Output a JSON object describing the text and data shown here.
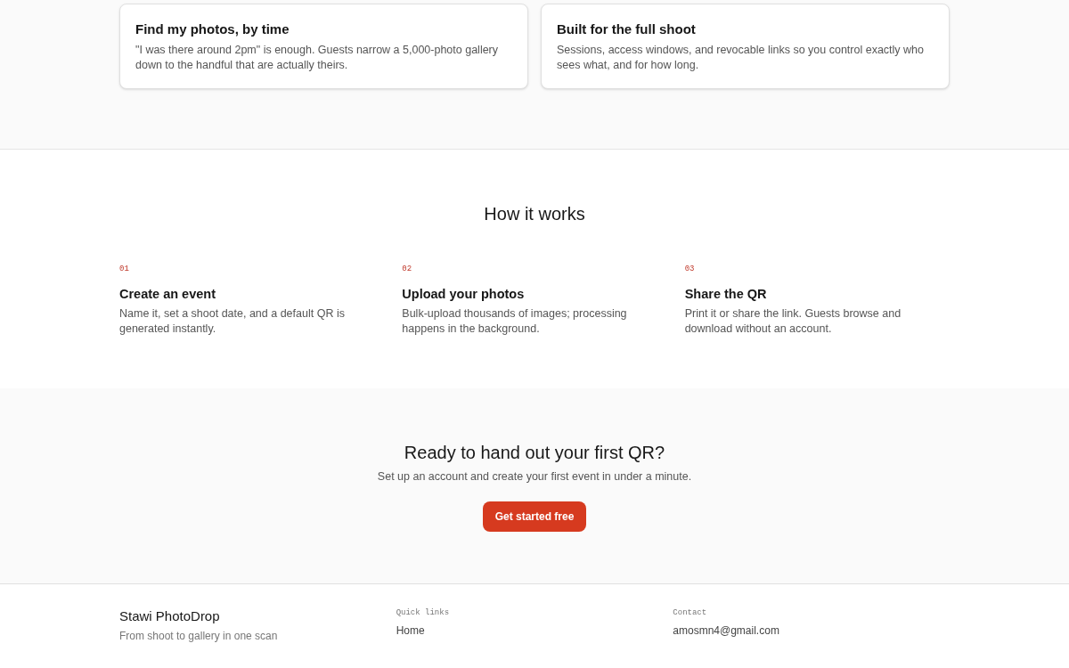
{
  "features": [
    {
      "title": "Find my photos, by time",
      "text": "\"I was there around 2pm\" is enough. Guests narrow a 5,000-photo gallery down to the handful that are actually theirs."
    },
    {
      "title": "Built for the full shoot",
      "text": "Sessions, access windows, and revocable links so you control exactly who sees what, and for how long."
    }
  ],
  "how_it_works": {
    "heading": "How it works",
    "steps": [
      {
        "number": "01",
        "title": "Create an event",
        "text": "Name it, set a shoot date, and a default QR is generated instantly."
      },
      {
        "number": "02",
        "title": "Upload your photos",
        "text": "Bulk-upload thousands of images; processing happens in the background."
      },
      {
        "number": "03",
        "title": "Share the QR",
        "text": "Print it or share the link. Guests browse and download without an account."
      }
    ]
  },
  "cta": {
    "heading": "Ready to hand out your first QR?",
    "text": "Set up an account and create your first event in under a minute.",
    "button": "Get started free"
  },
  "footer": {
    "brand": "Stawi PhotoDrop",
    "tagline": "From shoot to gallery in one scan",
    "columns": [
      {
        "heading": "Quick links",
        "links": [
          "Home"
        ]
      },
      {
        "heading": "Contact",
        "links": [
          "amosmn4@gmail.com"
        ]
      }
    ]
  }
}
